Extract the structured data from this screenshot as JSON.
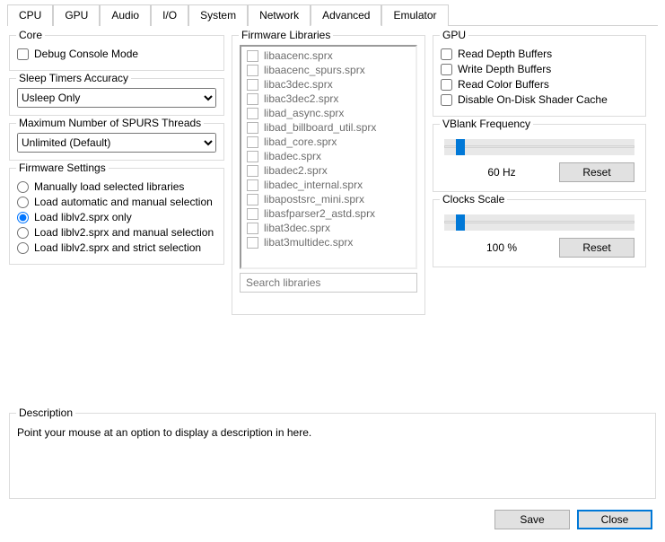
{
  "tabs": [
    "CPU",
    "GPU",
    "Audio",
    "I/O",
    "System",
    "Network",
    "Advanced",
    "Emulator"
  ],
  "active_tab": "Advanced",
  "core": {
    "title": "Core",
    "debug_console": "Debug Console Mode"
  },
  "sleep": {
    "title": "Sleep Timers Accuracy",
    "value": "Usleep Only"
  },
  "spurs": {
    "title": "Maximum Number of SPURS Threads",
    "value": "Unlimited (Default)"
  },
  "fw_settings": {
    "title": "Firmware Settings",
    "options": [
      "Manually load selected libraries",
      "Load automatic and manual selection",
      "Load liblv2.sprx only",
      "Load liblv2.sprx and manual selection",
      "Load liblv2.sprx and strict selection"
    ],
    "selected_index": 2
  },
  "fw_libs": {
    "title": "Firmware Libraries",
    "items": [
      "libaacenc.sprx",
      "libaacenc_spurs.sprx",
      "libac3dec.sprx",
      "libac3dec2.sprx",
      "libad_async.sprx",
      "libad_billboard_util.sprx",
      "libad_core.sprx",
      "libadec.sprx",
      "libadec2.sprx",
      "libadec_internal.sprx",
      "libapostsrc_mini.sprx",
      "libasfparser2_astd.sprx",
      "libat3dec.sprx",
      "libat3multidec.sprx"
    ],
    "search_placeholder": "Search libraries"
  },
  "gpu": {
    "title": "GPU",
    "opts": [
      "Read Depth Buffers",
      "Write Depth Buffers",
      "Read Color Buffers",
      "Disable On-Disk Shader Cache"
    ]
  },
  "vblank": {
    "title": "VBlank Frequency",
    "value_label": "60 Hz",
    "reset": "Reset",
    "thumb_pct": 6
  },
  "clocks": {
    "title": "Clocks Scale",
    "value_label": "100 %",
    "reset": "Reset",
    "thumb_pct": 6
  },
  "description": {
    "title": "Description",
    "text": "Point your mouse at an option to display a description in here."
  },
  "footer": {
    "save": "Save",
    "close": "Close"
  }
}
